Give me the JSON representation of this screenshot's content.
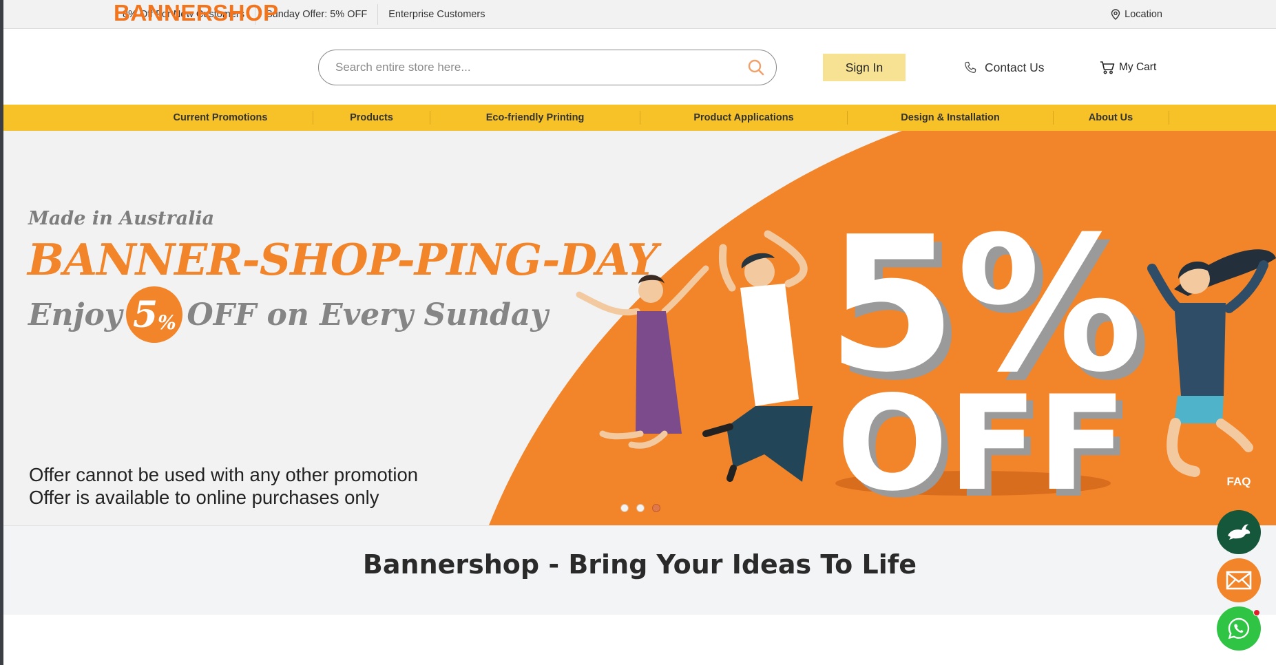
{
  "topbar": {
    "links": [
      "8% Off For New Customers",
      "Sunday Offer: 5% OFF",
      "Enterprise Customers"
    ],
    "location": "Location"
  },
  "header": {
    "logo": "BANNERSHOP",
    "search_placeholder": "Search entire store here...",
    "signin": "Sign In",
    "contact": "Contact Us",
    "cart": "My Cart"
  },
  "nav": {
    "items": [
      "Current Promotions",
      "Products",
      "Eco-friendly Printing",
      "Product Applications",
      "Design & Installation",
      "About Us"
    ]
  },
  "banner": {
    "made_in": "Made in Australia",
    "title": "BANNER-SHOP-PING-DAY",
    "enjoy": "Enjoy",
    "circle_number": "5",
    "circle_percent": "%",
    "off_text": "OFF on Every Sunday",
    "big_number": "5%",
    "big_off": "OFF",
    "note_line1": "Offer cannot be used with any other promotion",
    "note_line2": "Offer is available to online purchases only",
    "slides": 3,
    "active_slide": 3
  },
  "tagline": "Bannershop - Bring Your Ideas To Life",
  "floating": {
    "faq": "FAQ"
  },
  "colors": {
    "brand_orange": "#f2751e",
    "nav_yellow": "#f6c228",
    "signin_bg": "#f7e294",
    "banner_orange": "#f2842a"
  }
}
